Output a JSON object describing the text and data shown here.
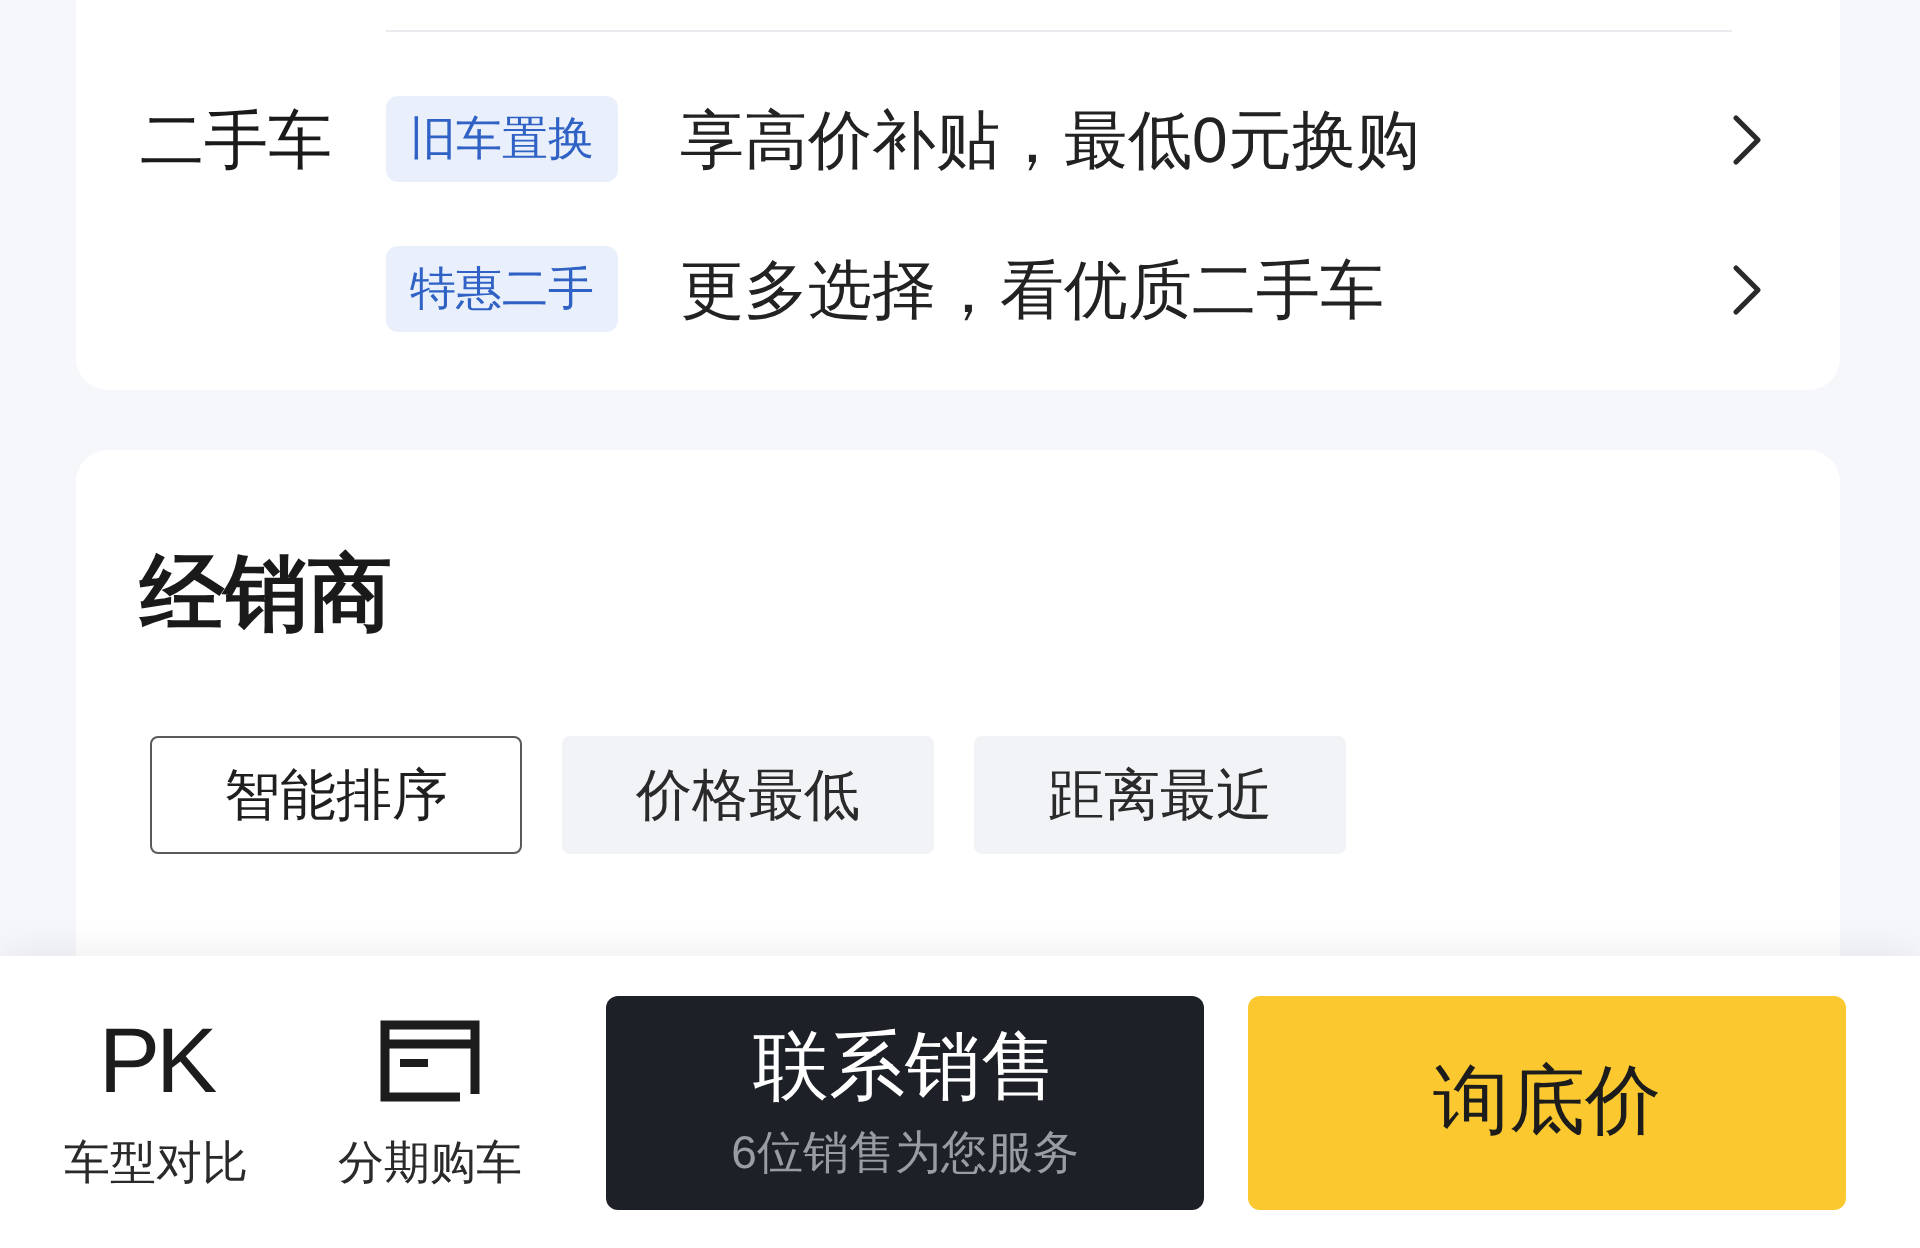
{
  "used_car": {
    "label": "二手车",
    "offers": [
      {
        "tag": "旧车置换",
        "text": "享高价补贴，最低0元换购"
      },
      {
        "tag": "特惠二手",
        "text": "更多选择，看优质二手车"
      }
    ]
  },
  "dealers": {
    "title": "经销商",
    "sort_options": [
      {
        "label": "智能排序",
        "selected": true
      },
      {
        "label": "价格最低",
        "selected": false
      },
      {
        "label": "距离最近",
        "selected": false
      }
    ]
  },
  "bottom_bar": {
    "actions": [
      {
        "kind": "text",
        "icon_text": "PK",
        "label": "车型对比"
      },
      {
        "kind": "card",
        "label": "分期购车"
      }
    ],
    "contact_button": {
      "label": "联系销售",
      "subtitle": "6位销售为您服务"
    },
    "price_button": {
      "label": "询底价"
    }
  }
}
